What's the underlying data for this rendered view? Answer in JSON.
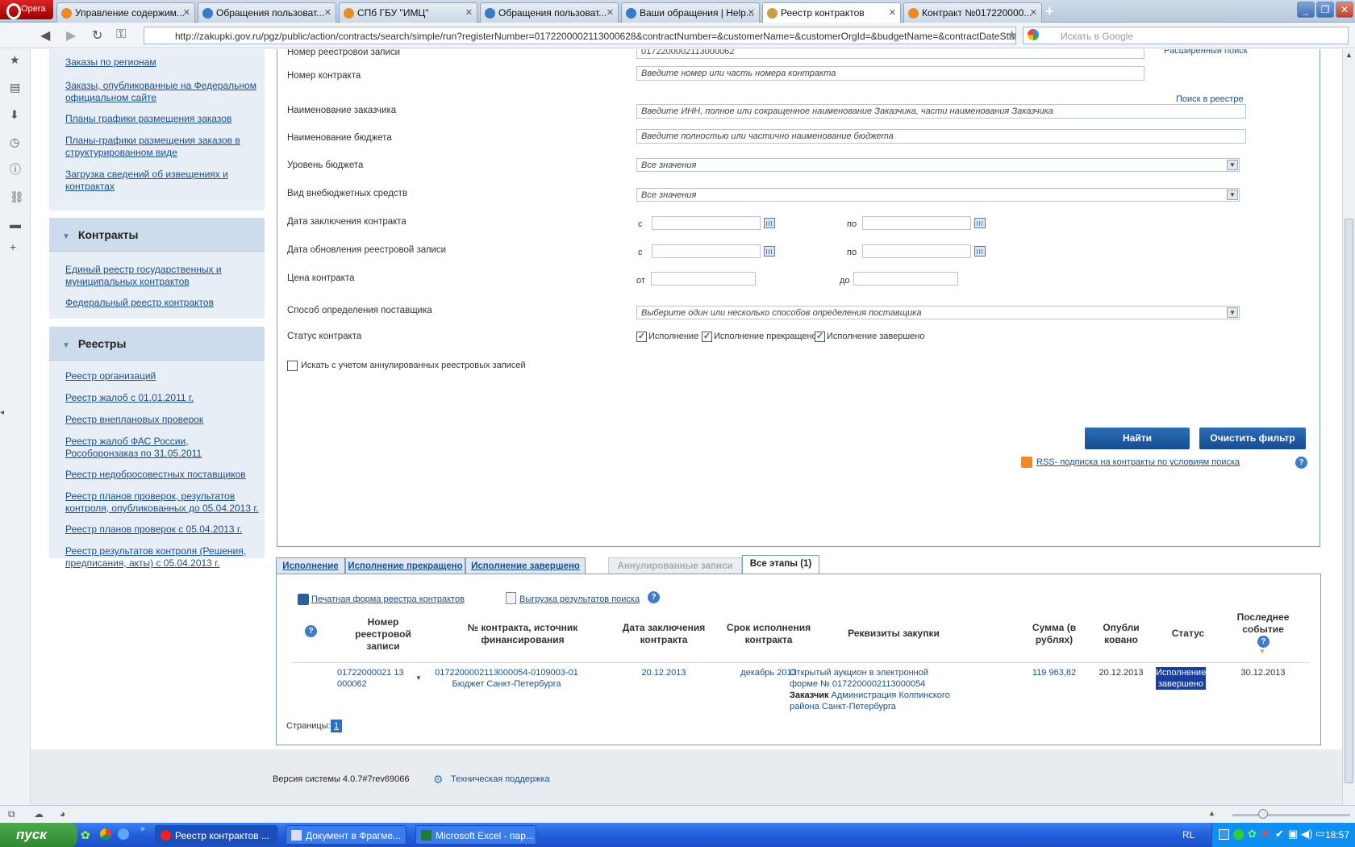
{
  "browser": {
    "app_name": "Opera",
    "tabs": [
      {
        "label": "Управление содержим...",
        "icon_color": "#e88a2a"
      },
      {
        "label": "Обращения пользоват...",
        "icon_color": "#3a78c8"
      },
      {
        "label": "СПб ГБУ \"ИМЦ\"",
        "icon_color": "#e88a2a"
      },
      {
        "label": "Обращения пользоват...",
        "icon_color": "#3a78c8"
      },
      {
        "label": "Ваши обращения | Help...",
        "icon_color": "#3a78c8"
      },
      {
        "label": "Реестр контрактов",
        "icon_color": "#c8a040"
      },
      {
        "label": "Контракт №017220000...",
        "icon_color": "#e88a2a"
      }
    ],
    "url": "http://zakupki.gov.ru/pgz/public/action/contracts/search/simple/run?registerNumber=0172200002113000628&contractNumber=&customerName=&customerOrgId=&budgetName=&contractDateStart=&contract",
    "search_placeholder": "Искать в Google"
  },
  "sidebar": {
    "top_links": [
      "Заказы по регионам",
      "Заказы, опубликованные на Федеральном официальном сайте",
      "Планы графики размещения заказов",
      "Планы-графики размещения заказов в структурированном виде",
      "Загрузка сведений об извещениях и контрактах"
    ],
    "contracts_title": "Контракты",
    "contracts_links": [
      "Единый реестр государственных и муниципальных контрактов",
      "Федеральный реестр контрактов"
    ],
    "registries_title": "Реестры",
    "registries_links": [
      "Реестр организаций",
      "Реестр жалоб с 01.01.2011 г.",
      "Реестр внеплановых проверок",
      "Реестр жалоб ФАС России, Рособоронзаказ по 31.05.2011",
      "Реестр недобросовестных поставщиков",
      "Реестр планов проверок, результатов контроля, опубликованных до 05.04.2013 г.",
      "Реестр планов проверок с 05.04.2013 г.",
      "Реестр результатов контроля (Решения, предписания, акты) с 05.04.2013 г."
    ]
  },
  "form": {
    "registry_number_label": "Номер реестровой записи",
    "registry_number_value": "0172200002113000062",
    "advanced_search": "Расширенный поиск",
    "contract_number_label": "Номер контракта",
    "contract_number_placeholder": "Введите номер или часть номера контракта",
    "registry_search": "Поиск в реестре",
    "customer_label": "Наименование заказчика",
    "customer_placeholder": "Введите ИНН, полное или сокращенное наименование Заказчика, части наименования Заказчика",
    "budget_name_label": "Наименование бюджета",
    "budget_name_placeholder": "Введите полностью или частично наименование бюджета",
    "budget_level_label": "Уровень бюджета",
    "budget_level_value": "Все значения",
    "offbudget_label": "Вид внебюджетных средств",
    "offbudget_value": "Все значения",
    "contract_date_label": "Дата заключения контракта",
    "update_date_label": "Дата обновления реестровой записи",
    "from": "с",
    "to": "по",
    "price_label": "Цена контракта",
    "price_from": "от",
    "price_to": "до",
    "supplier_method_label": "Способ определения поставщика",
    "supplier_method_placeholder": "Выберите один или несколько способов определения поставщика",
    "status_label": "Статус контракта",
    "status_options": [
      "Исполнение",
      "Исполнение прекращено",
      "Исполнение завершено"
    ],
    "annulled_label": "Искать с учетом аннулированных реестровых записей",
    "find_button": "Найти",
    "clear_button": "Очистить фильтр",
    "rss_link": "RSS- подписка на контракты по условиям поиска"
  },
  "results": {
    "tabs": [
      "Исполнение",
      "Исполнение прекращено",
      "Исполнение завершено",
      "Аннулированные записи",
      "Все этапы (1)"
    ],
    "print_link": "Печатная форма реестра контрактов",
    "export_link": "Выгрузка результатов поиска",
    "columns": [
      "Номер реестровой записи",
      "№ контракта, источник финансирования",
      "Дата заключения контракта",
      "Срок исполнения контракта",
      "Реквизиты закупки",
      "Сумма (в рублях)",
      "Опубли ковано",
      "Статус",
      "Последнее событие"
    ],
    "row": {
      "registry_number": "01722000021 13 000062",
      "contract_number": "0172200002113000054-0109003-01",
      "funding": "Бюджет Санкт-Петербурга",
      "conclusion_date": "20.12.2013",
      "execution_term": "декабрь 2013",
      "procurement": "Открытый аукцион в электронной форме № 0172200002113000054",
      "customer_label": "Заказчик",
      "customer": "Администрация Колпинского района Санкт-Петербурга",
      "amount": "119 963,82",
      "published": "20.12.2013",
      "status": "Исполнение завершено",
      "last_event": "30.12.2013"
    },
    "pages_label": "Страницы:",
    "page": "1"
  },
  "footer": {
    "version": "Версия системы 4.0.7#7rev69066",
    "support": "Техническая поддержка"
  },
  "taskbar": {
    "start": "пуск",
    "tasks": [
      "Реестр контрактов ...",
      "Документ в Фрагме...",
      "Microsoft Excel - пар..."
    ],
    "lang": "RL",
    "time": "18:57"
  }
}
